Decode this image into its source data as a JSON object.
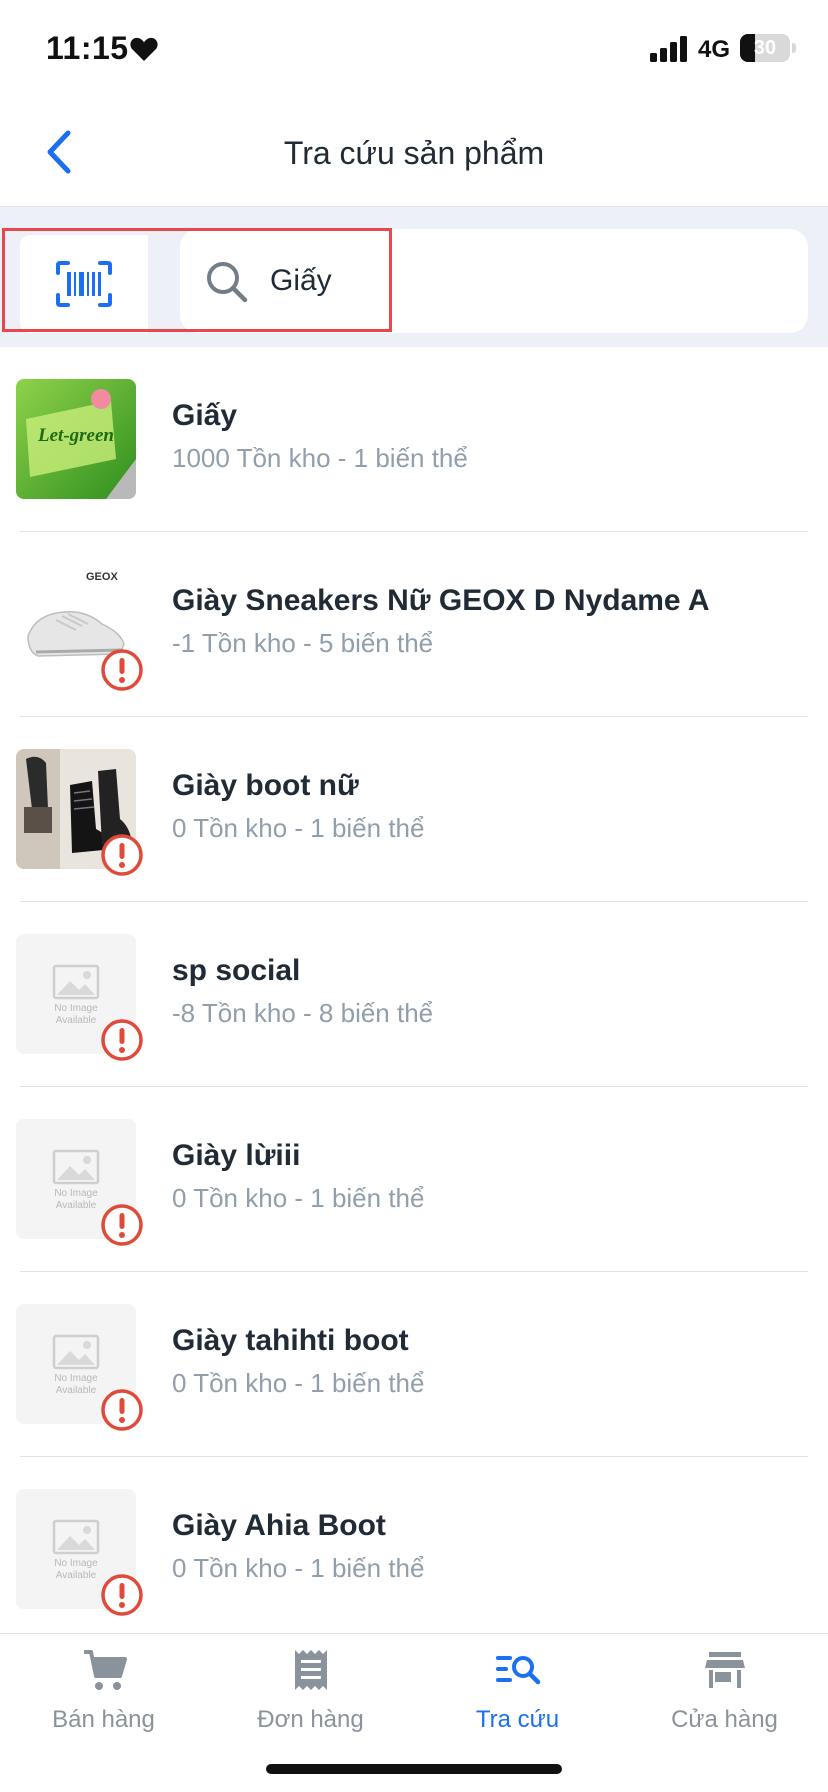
{
  "status_bar": {
    "time": "11:15",
    "network": "4G",
    "battery": "30",
    "battery_level": 0.3,
    "icons": [
      "heart-icon",
      "signal-icon",
      "battery-icon"
    ]
  },
  "header": {
    "title": "Tra cứu sản phẩm",
    "back_icon": "chevron-left-icon"
  },
  "search": {
    "value": "Giấy",
    "scan_icon": "barcode-scan-icon",
    "search_icon": "search-icon"
  },
  "products": [
    {
      "name": "Giấy",
      "meta": "1000 Tồn kho - 1 biến thể",
      "thumb": "let-green-photo",
      "warning": false
    },
    {
      "name": "Giày Sneakers Nữ GEOX D Nydame A",
      "meta": "-1 Tồn kho - 5 biến thể",
      "thumb": "geox-sneaker-photo",
      "thumb_brand": "GEOX",
      "warning": true
    },
    {
      "name": "Giày boot nữ",
      "meta": "0 Tồn kho - 1 biến thể",
      "thumb": "boot-photo",
      "warning": true
    },
    {
      "name": "sp social",
      "meta": "-8 Tồn kho - 8 biến thể",
      "thumb": "no-image",
      "warning": true
    },
    {
      "name": "Giày lừiii",
      "meta": "0 Tồn kho - 1 biến thể",
      "thumb": "no-image",
      "warning": true
    },
    {
      "name": "Giày tahihti boot",
      "meta": "0 Tồn kho - 1 biến thể",
      "thumb": "no-image",
      "warning": true
    },
    {
      "name": "Giày Ahia Boot",
      "meta": "0 Tồn kho - 1 biến thể",
      "thumb": "no-image",
      "warning": true
    }
  ],
  "no_image_text": {
    "line1": "No Image",
    "line2": "Available"
  },
  "let_green_text": "Let-green",
  "bottom_nav": [
    {
      "label": "Bán hàng",
      "icon": "cart-icon",
      "active": false
    },
    {
      "label": "Đơn hàng",
      "icon": "receipt-icon",
      "active": false
    },
    {
      "label": "Tra cứu",
      "icon": "lookup-icon",
      "active": true
    },
    {
      "label": "Cửa hàng",
      "icon": "store-icon",
      "active": false
    }
  ],
  "colors": {
    "accent": "#1b6ff0",
    "warning": "#e04a3a",
    "highlight": "#e8474b",
    "search_bg": "#eef0f7"
  }
}
